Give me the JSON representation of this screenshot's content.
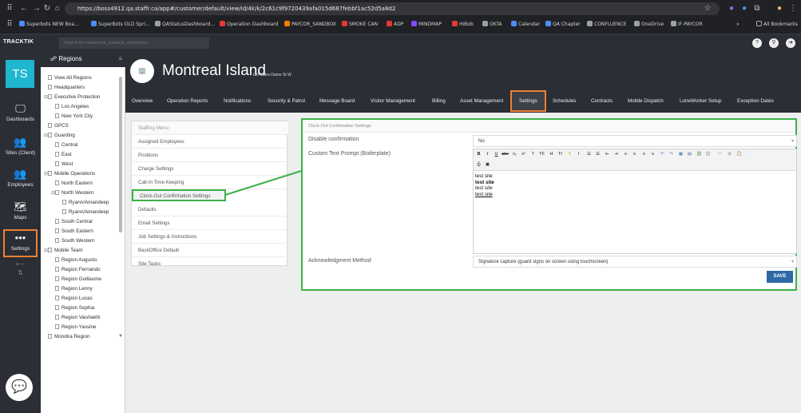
{
  "browser": {
    "url": "https://boss4912.qa.staffr.ca/app#/customer/default/view/id/4k/k/2c61c9f9720439afa015d687febbf1ac52d5a8d2",
    "bookmarks": [
      "Superbots NEW Boa...",
      "SuperBots OLD Spri...",
      "QAStatusDashboard...",
      "Operation Dashboard",
      "PAYCOR_SANDBOX",
      "SMOKE CAN",
      "ADP",
      "MINDMAP",
      "HiBob",
      "OKTA",
      "Calendar",
      "QA Chapter",
      "CONFLUENCE",
      "OneDrive",
      "IF-PAYCOR",
      "All Bookmarks"
    ]
  },
  "app": {
    "logo": "TRACKTIK",
    "search_placeholder": "Search for customers, contacts, employees",
    "top_icons": [
      "?",
      "⚲",
      "➜"
    ]
  },
  "iconnav": {
    "initials": "TS",
    "items": [
      {
        "label": "Dashboards",
        "icon": "monitor-icon"
      },
      {
        "label": "Sites (Client)",
        "icon": "group-icon"
      },
      {
        "label": "Employees",
        "icon": "employees-icon"
      },
      {
        "label": "Maps",
        "icon": "map-icon"
      },
      {
        "label": "Settings",
        "icon": "more-dots-icon"
      }
    ]
  },
  "tree": {
    "title": "Regions",
    "nodes": [
      {
        "label": "View All Regions",
        "level": 0,
        "exp": false
      },
      {
        "label": "Headquarters",
        "level": 0,
        "exp": false
      },
      {
        "label": "Executive Protection",
        "level": 0,
        "exp": true
      },
      {
        "label": "Los Angeles",
        "level": 1,
        "exp": false
      },
      {
        "label": "New York City",
        "level": 1,
        "exp": false
      },
      {
        "label": "GPCS",
        "level": 0,
        "exp": false
      },
      {
        "label": "Guarding",
        "level": 0,
        "exp": true
      },
      {
        "label": "Central",
        "level": 1,
        "exp": false
      },
      {
        "label": "East",
        "level": 1,
        "exp": false
      },
      {
        "label": "West",
        "level": 1,
        "exp": false
      },
      {
        "label": "Mobile Operations",
        "level": 0,
        "exp": true
      },
      {
        "label": "North Eastern",
        "level": 1,
        "exp": false
      },
      {
        "label": "North Western",
        "level": 1,
        "exp": true
      },
      {
        "label": "Ryann/Amandeep",
        "level": 2,
        "exp": false
      },
      {
        "label": "Ryann/Amandeep",
        "level": 2,
        "exp": false
      },
      {
        "label": "South Central",
        "level": 1,
        "exp": false
      },
      {
        "label": "South Eastern",
        "level": 1,
        "exp": false
      },
      {
        "label": "South Western",
        "level": 1,
        "exp": false
      },
      {
        "label": "Mobile Team",
        "level": 0,
        "exp": true
      },
      {
        "label": "Region Augusto",
        "level": 1,
        "exp": false
      },
      {
        "label": "Region Fernando",
        "level": 1,
        "exp": false
      },
      {
        "label": "Region Guillaume",
        "level": 1,
        "exp": false
      },
      {
        "label": "Region Lenny",
        "level": 1,
        "exp": false
      },
      {
        "label": "Region Lucas",
        "level": 1,
        "exp": false
      },
      {
        "label": "Region Sophia",
        "level": 1,
        "exp": false
      },
      {
        "label": "Region Vaishakhi",
        "level": 1,
        "exp": false
      },
      {
        "label": "Region Yassine",
        "level": 1,
        "exp": false
      },
      {
        "label": "Mondira Region",
        "level": 0,
        "exp": false
      }
    ]
  },
  "site": {
    "name": "Montreal Island",
    "address": "110 Notre-Dame St W"
  },
  "tabs": [
    "Overview",
    "Operation Reports",
    "Notifications",
    "Security & Patrol",
    "Message Board",
    "Visitor Management",
    "Billing",
    "Asset Management",
    "Settings",
    "Schedules",
    "Contracts",
    "Mobile Dispatch",
    "LoneWorker Setup",
    "Exception Dates"
  ],
  "active_tab": "Settings",
  "staffing_menu": {
    "header": "Staffing Menu",
    "items": [
      "Assigned Employees",
      "Positions",
      "Charge Settings",
      "Call-In Time Keeping",
      "Clock-Out Confirmation Settings",
      "Defaults",
      "Email Settings",
      "Job Settings & Instructions",
      "BackOffice Default",
      "Site Tasks"
    ],
    "active": "Clock-Out Confirmation Settings"
  },
  "form": {
    "title": "Clock-Out Confirmation Settings",
    "disable_label": "Disable confirmation",
    "disable_value": "No",
    "prompt_label": "Custom Text Prompt (Boilerplate)",
    "editor_lines": [
      "test site",
      "test site",
      "test site",
      "test site"
    ],
    "ack_label": "Acknowledgment Method",
    "ack_value": "Signature capture (guard signs on screen using touchscreen)",
    "save_label": "SAVE"
  },
  "colors": {
    "accent_orange": "#f07f33",
    "highlight_green": "#3cb24a",
    "save_blue": "#2d6aa6",
    "brand_cyan": "#1fb6d0"
  }
}
